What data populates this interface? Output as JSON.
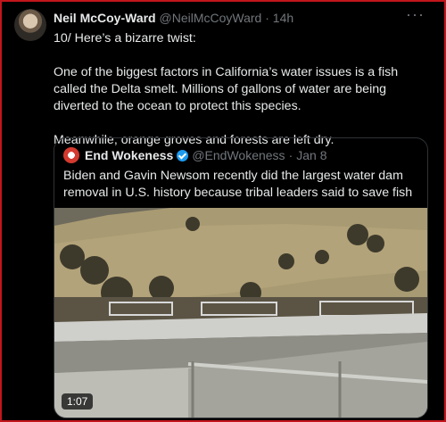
{
  "tweet": {
    "author_name": "Neil McCoy-Ward",
    "handle": "@NeilMcCoyWard",
    "separator": "·",
    "time": "14h",
    "more_icon": "more-icon",
    "paragraphs": [
      "10/ Here’s a bizarre twist:",
      "One of the biggest factors in California’s water issues is a fish called the Delta smelt. Millions of gallons of water are being diverted to the ocean to protect this species.",
      "Meanwhile, orange groves and forests are left dry."
    ]
  },
  "quote": {
    "author_name": "End Wokeness",
    "verified_icon": "verified-badge-icon",
    "handle": "@EndWokeness",
    "separator": "·",
    "date": "Jan 8",
    "text": "Biden and Gavin Newsom recently did the largest water dam removal in U.S. history because tribal leaders said to save fish",
    "video": {
      "duration": "1:07"
    }
  },
  "colors": {
    "background": "#000000",
    "text": "#e7e9ea",
    "muted": "#71767b",
    "verified": "#1d9bf0",
    "frame": "#c2161c"
  }
}
